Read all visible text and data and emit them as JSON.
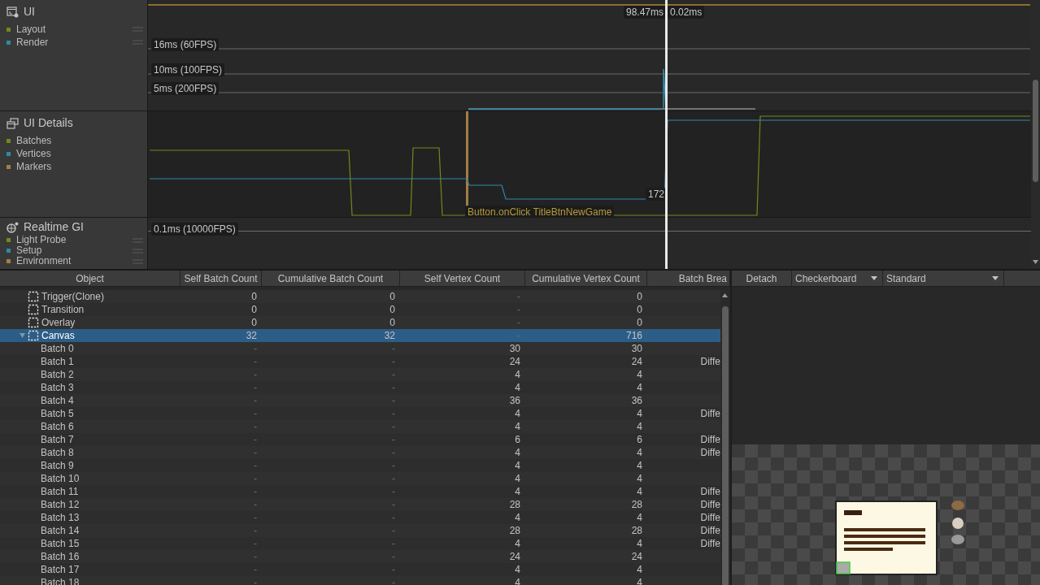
{
  "profiler_modules": [
    {
      "kind": "ui",
      "title": "UI",
      "reorderable": true,
      "series": [
        {
          "name": "Layout",
          "color": "#6f8a1c"
        },
        {
          "name": "Render",
          "color": "#2f89a8"
        }
      ],
      "thresholds": [
        "16ms (60FPS)",
        "10ms (100FPS)",
        "5ms (200FPS)"
      ],
      "selection_time": "98.47ms",
      "selection_value": "0.02ms"
    },
    {
      "kind": "ui_details",
      "title": "UI Details",
      "reorderable": false,
      "series": [
        {
          "name": "Batches",
          "color": "#6f8a1c"
        },
        {
          "name": "Vertices",
          "color": "#2f89a8"
        },
        {
          "name": "Markers",
          "color": "#a27f45"
        }
      ],
      "value_label": "172",
      "marker_label": "Button.onClick TitleBtnNewGame"
    },
    {
      "kind": "gi",
      "title": "Realtime GI",
      "reorderable": true,
      "series": [
        {
          "name": "Light Probe",
          "color": "#6f8a1c"
        },
        {
          "name": "Setup",
          "color": "#2f89a8"
        },
        {
          "name": "Environment",
          "color": "#a27f45"
        }
      ],
      "thresholds": [
        "0.1ms (10000FPS)"
      ]
    }
  ],
  "table": {
    "columns": [
      "Object",
      "Self Batch Count",
      "Cumulative Batch Count",
      "Self Vertex Count",
      "Cumulative Vertex Count",
      "Batch Brea"
    ],
    "rows": [
      {
        "cells": [
          "Trigger(Clone)",
          "0",
          "0",
          "-",
          "0"
        ],
        "selected": false
      },
      {
        "cells": [
          "Transition",
          "0",
          "0",
          "-",
          "0"
        ],
        "selected": false
      },
      {
        "cells": [
          "Overlay",
          "0",
          "0",
          "-",
          "0"
        ],
        "selected": false
      },
      {
        "cells": [
          "Canvas",
          "32",
          "32",
          "-",
          "716"
        ],
        "selected": true,
        "expanded": true,
        "children": [
          {
            "cells": [
              "Batch 0",
              "-",
              "-",
              "30",
              "30"
            ],
            "selected": false
          },
          {
            "cells": [
              "Batch 1",
              "-",
              "-",
              "24",
              "24",
              "Diffe"
            ],
            "selected": false
          },
          {
            "cells": [
              "Batch 2",
              "-",
              "-",
              "4",
              "4"
            ],
            "selected": false
          },
          {
            "cells": [
              "Batch 3",
              "-",
              "-",
              "4",
              "4"
            ],
            "selected": false
          },
          {
            "cells": [
              "Batch 4",
              "-",
              "-",
              "36",
              "36"
            ],
            "selected": false
          },
          {
            "cells": [
              "Batch 5",
              "-",
              "-",
              "4",
              "4",
              "Diffe"
            ],
            "selected": false
          },
          {
            "cells": [
              "Batch 6",
              "-",
              "-",
              "4",
              "4"
            ],
            "selected": false
          },
          {
            "cells": [
              "Batch 7",
              "-",
              "-",
              "6",
              "6",
              "Diffe"
            ],
            "selected": false
          },
          {
            "cells": [
              "Batch 8",
              "-",
              "-",
              "4",
              "4",
              "Diffe"
            ],
            "selected": false
          },
          {
            "cells": [
              "Batch 9",
              "-",
              "-",
              "4",
              "4"
            ],
            "selected": false
          },
          {
            "cells": [
              "Batch 10",
              "-",
              "-",
              "4",
              "4"
            ],
            "selected": false
          },
          {
            "cells": [
              "Batch 11",
              "-",
              "-",
              "4",
              "4",
              "Diffe"
            ],
            "selected": false
          },
          {
            "cells": [
              "Batch 12",
              "-",
              "-",
              "28",
              "28",
              "Diffe"
            ],
            "selected": false
          },
          {
            "cells": [
              "Batch 13",
              "-",
              "-",
              "4",
              "4",
              "Diffe"
            ],
            "selected": false
          },
          {
            "cells": [
              "Batch 14",
              "-",
              "-",
              "28",
              "28",
              "Diffe"
            ],
            "selected": false
          },
          {
            "cells": [
              "Batch 15",
              "-",
              "-",
              "4",
              "4",
              "Diffe"
            ],
            "selected": false
          },
          {
            "cells": [
              "Batch 16",
              "-",
              "-",
              "24",
              "24"
            ],
            "selected": false
          },
          {
            "cells": [
              "Batch 17",
              "-",
              "-",
              "4",
              "4"
            ],
            "selected": false
          },
          {
            "cells": [
              "Batch 18",
              "-",
              "-",
              "4",
              "4"
            ],
            "selected": false
          }
        ]
      }
    ]
  },
  "preview": {
    "detach": "Detach",
    "background": "Checkerboard",
    "shader": "Standard"
  }
}
